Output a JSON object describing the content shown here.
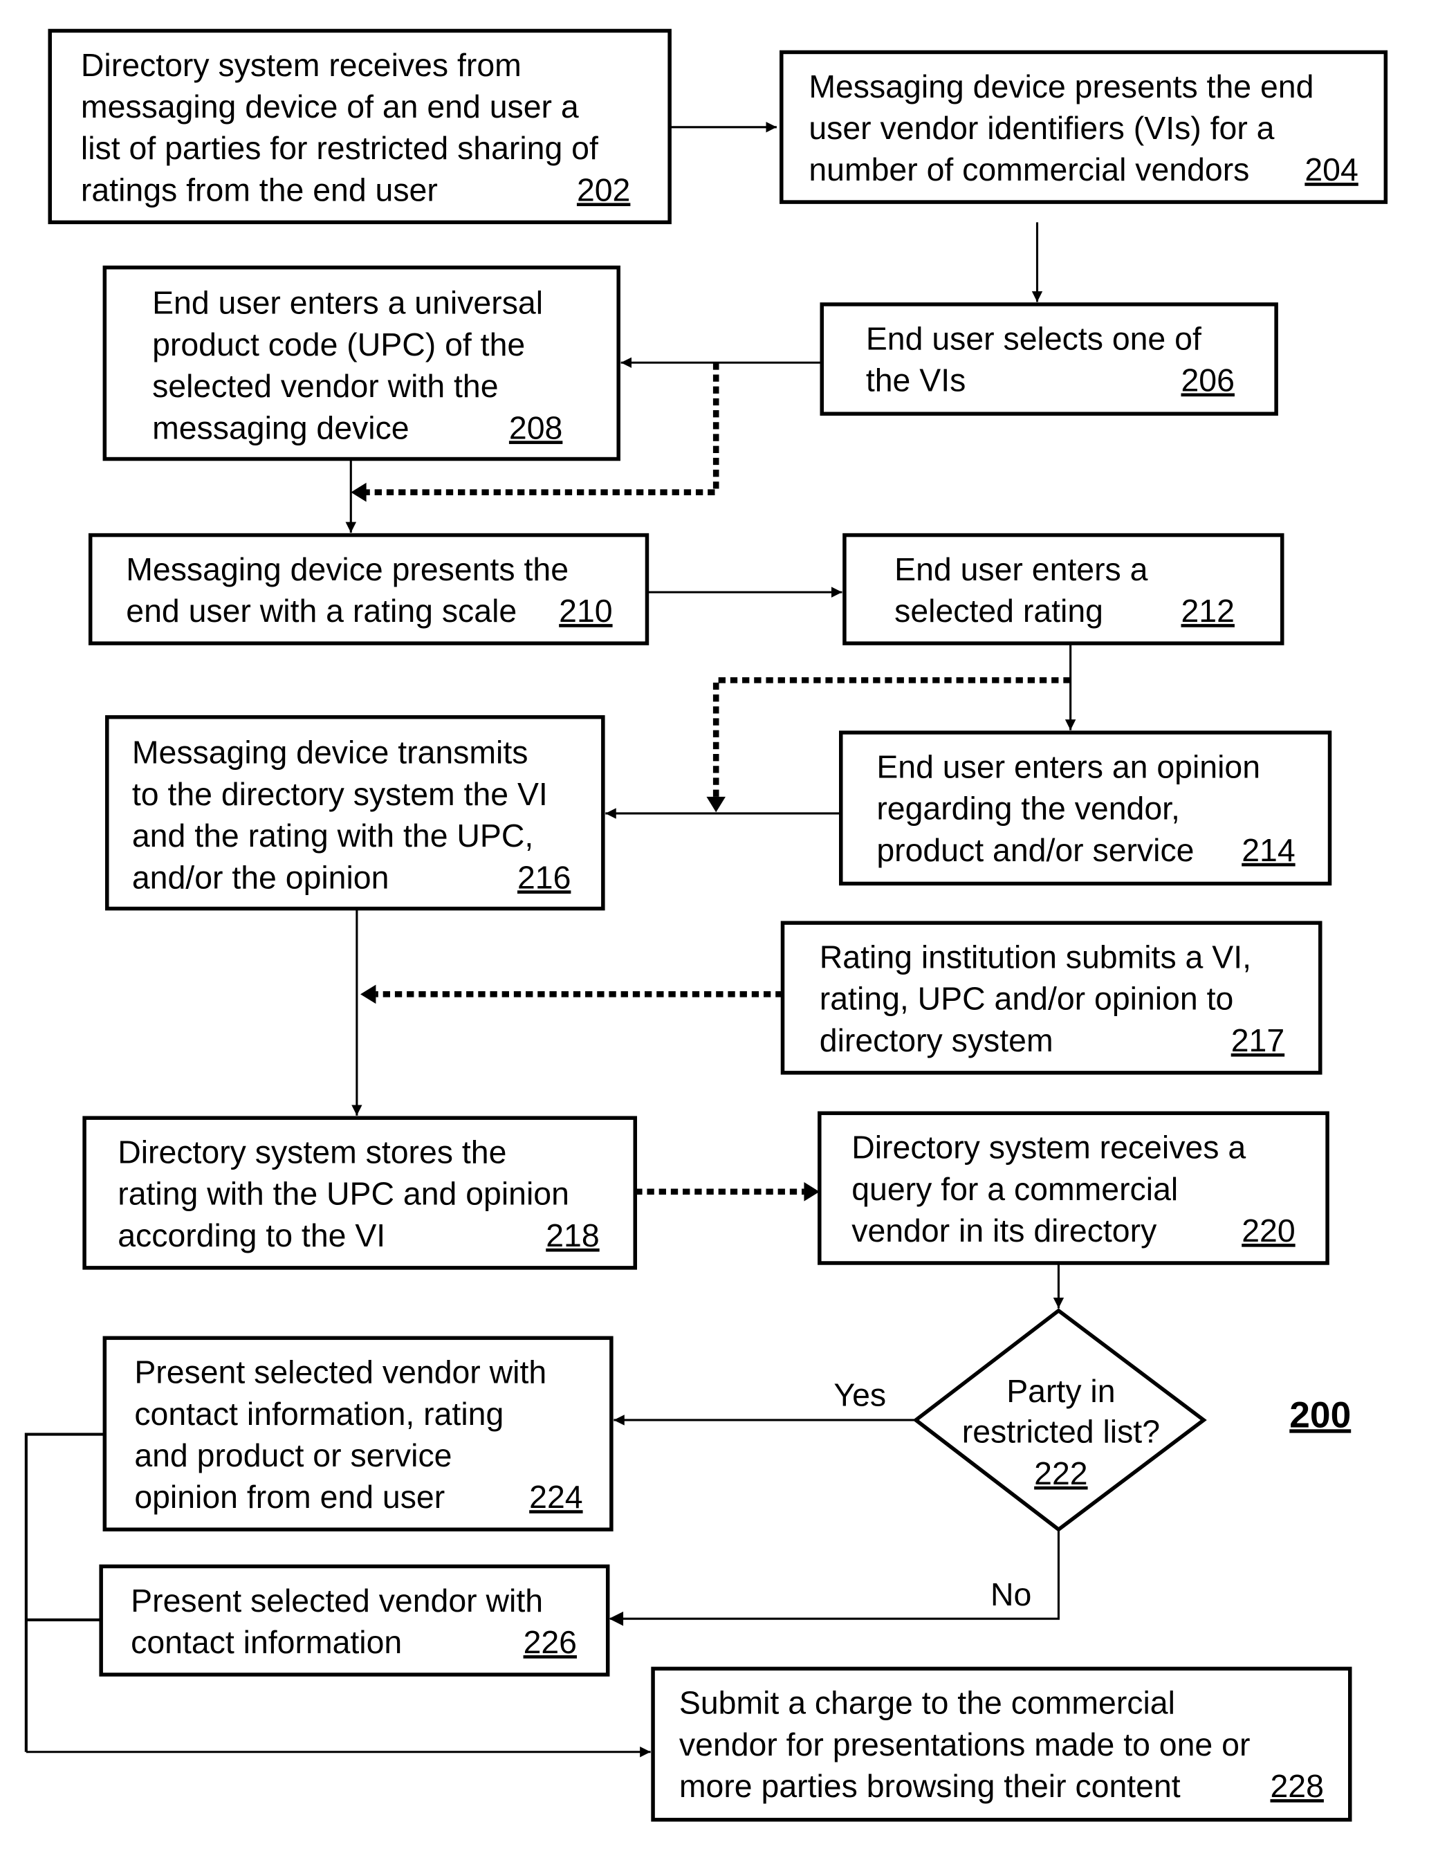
{
  "figure_label": "200",
  "steps": {
    "s202": {
      "lines": [
        "Directory system receives from",
        "messaging device of an end user a",
        "list of parties for restricted sharing of",
        "ratings from the end user"
      ],
      "ref": "202"
    },
    "s204": {
      "lines": [
        "Messaging device presents the end",
        "user vendor identifiers (VIs) for a",
        "number of commercial vendors"
      ],
      "ref": "204"
    },
    "s206": {
      "lines": [
        "End user selects one of",
        "the VIs"
      ],
      "ref": "206"
    },
    "s208": {
      "lines": [
        "End user enters a universal",
        "product code (UPC) of the",
        "selected vendor with the",
        "messaging device"
      ],
      "ref": "208"
    },
    "s210": {
      "lines": [
        "Messaging device presents the",
        "end user with a rating scale"
      ],
      "ref": "210"
    },
    "s212": {
      "lines": [
        "End user enters a",
        "selected rating"
      ],
      "ref": "212"
    },
    "s214": {
      "lines": [
        "End user enters an opinion",
        "regarding the vendor,",
        "product and/or service"
      ],
      "ref": "214"
    },
    "s216": {
      "lines": [
        "Messaging device transmits",
        "to the directory system the VI",
        "and the rating with the UPC,",
        "and/or the opinion"
      ],
      "ref": "216"
    },
    "s217": {
      "lines": [
        "Rating institution submits a VI,",
        "rating, UPC and/or opinion to",
        "directory system"
      ],
      "ref": "217"
    },
    "s218": {
      "lines": [
        "Directory system stores the",
        "rating with the UPC and opinion",
        "according to the VI"
      ],
      "ref": "218"
    },
    "s220": {
      "lines": [
        "Directory system receives a",
        "query for a commercial",
        "vendor in its directory"
      ],
      "ref": "220"
    },
    "s222": {
      "lines": [
        "Party in",
        "restricted list?"
      ],
      "ref": "222"
    },
    "s224": {
      "lines": [
        "Present selected vendor with",
        "contact information, rating",
        "and product or service",
        "opinion from end user"
      ],
      "ref": "224"
    },
    "s226": {
      "lines": [
        "Present selected vendor with",
        "contact information"
      ],
      "ref": "226"
    },
    "s228": {
      "lines": [
        "Submit a charge to the commercial",
        "vendor for presentations made to one or",
        "more parties browsing their content"
      ],
      "ref": "228"
    }
  },
  "branch_labels": {
    "yes": "Yes",
    "no": "No"
  }
}
